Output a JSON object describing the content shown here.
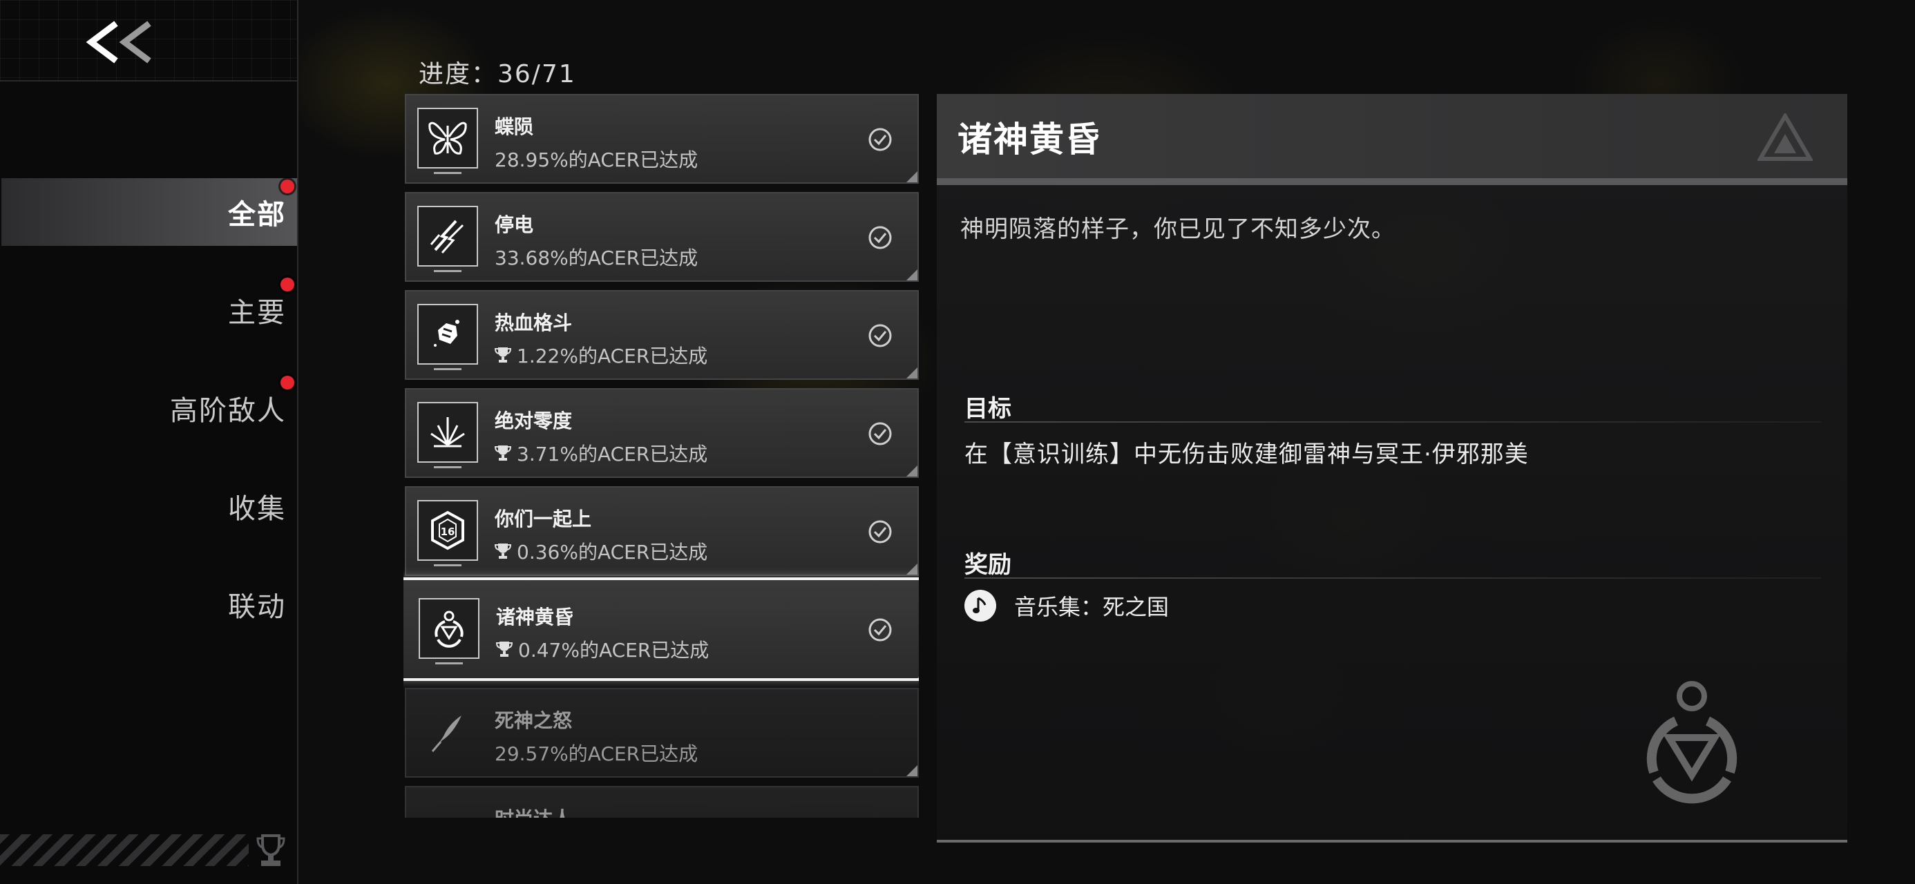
{
  "sidebar": {
    "back_label": "<<",
    "nav_items": [
      {
        "label": "全部",
        "active": true,
        "notification": true
      },
      {
        "label": "主要",
        "active": false,
        "notification": true
      },
      {
        "label": "高阶敌人",
        "active": false,
        "notification": true
      },
      {
        "label": "收集",
        "active": false,
        "notification": false
      },
      {
        "label": "联动",
        "active": false,
        "notification": false
      }
    ]
  },
  "progress": {
    "text": "进度：36/71"
  },
  "achievements": [
    {
      "title": "蝶陨",
      "stat": "28.95%的ACER已达成",
      "trophy": false,
      "completed": true,
      "icon": "butterfly-icon"
    },
    {
      "title": "停电",
      "stat": "33.68%的ACER已达成",
      "trophy": false,
      "completed": true,
      "icon": "lightning-claw-icon"
    },
    {
      "title": "热血格斗",
      "stat": "1.22%的ACER已达成",
      "trophy": true,
      "completed": true,
      "icon": "fist-icon"
    },
    {
      "title": "绝对零度",
      "stat": "3.71%的ACER已达成",
      "trophy": true,
      "completed": true,
      "icon": "ice-crystal-icon"
    },
    {
      "title": "你们一起上",
      "stat": "0.36%的ACER已达成",
      "trophy": true,
      "completed": true,
      "icon": "hexagon-16-icon"
    },
    {
      "title": "诸神黄昏",
      "stat": "0.47%的ACER已达成",
      "trophy": true,
      "completed": true,
      "selected": true,
      "icon": "divine-emblem-icon"
    },
    {
      "title": "死神之怒",
      "stat": "29.57%的ACER已达成",
      "trophy": false,
      "completed": false,
      "icon": "feather-blade-icon"
    },
    {
      "title": "时尚达人",
      "stat": "",
      "trophy": false,
      "completed": false,
      "icon": "fashion-icon"
    }
  ],
  "detail": {
    "title": "诸神黄昏",
    "description": "神明陨落的样子，你已见了不知多少次。",
    "goal_label": "目标",
    "goal_text": "在【意识训练】中无伤击败建御雷神与冥王·伊邪那美",
    "reward_label": "奖励",
    "reward_text": "音乐集：死之国",
    "reward_icon": "music-note-icon"
  },
  "colors": {
    "accent_red": "#e8252f",
    "selected_border": "#f2f2f2"
  }
}
